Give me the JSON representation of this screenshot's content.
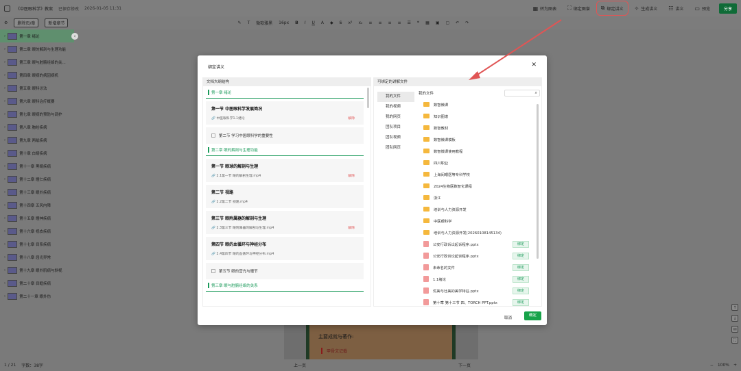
{
  "topbar": {
    "doc_title": "《中医眼科学》教案",
    "save_status": "已保存修改",
    "save_time": "2026-01-05 11:31",
    "buttons": [
      {
        "label": "转为图表",
        "icon": "chart-icon"
      },
      {
        "label": "绑定图谱",
        "icon": "graph-icon"
      },
      {
        "label": "绑定讲义",
        "icon": "handout-icon"
      },
      {
        "label": "生成讲义",
        "icon": "generate-icon"
      },
      {
        "label": "讲义",
        "icon": "doc-icon"
      },
      {
        "label": "预览",
        "icon": "preview-icon"
      }
    ],
    "share_label": "分享"
  },
  "toolbar2": {
    "delete_label": "删除页/章",
    "new_chapter_label": "新增章节",
    "font_name": "微软雅黑",
    "font_size": "16px"
  },
  "sidebar": {
    "items": [
      "第一章 绪论",
      "第二章 眼的解剖与生理功能",
      "第三章 眼与脏腑经络的关...",
      "第四章 眼病的病因病机",
      "第五章 眼科诊法",
      "第六章 眼科治疗概要",
      "第七章 眼病的预防与调护",
      "第八章 胞睑疾病",
      "第九章 两眦疾病",
      "第十章 白睛疾病",
      "第十一章 黑睛疾病",
      "第十二章 瞳仁疾病",
      "第十三章 眼外疾病",
      "第十四章 五风内障",
      "第十五章 瞳神疾病",
      "第十六章 视衣疾病",
      "第十七章 目系疾病",
      "第十八章 屈光异常",
      "第十九章 眼外肌病与斜视",
      "第二十章 目眶疾病",
      "第二十一章 眼外伤"
    ]
  },
  "statusbar": {
    "page_info": "1 / 21",
    "word_count": "字数：38字",
    "prev_label": "上一页",
    "next_label": "下一页",
    "zoom": "100%"
  },
  "canvas": {
    "line1": "主要成就与著作:",
    "line2": "甲骨文记载"
  },
  "modal": {
    "title": "绑定讲义",
    "left_header": "文档大纲结构",
    "right_header": "可绑定的讲解文件",
    "outline": [
      {
        "type": "chapter",
        "title": "第一章 绪论"
      },
      {
        "type": "section",
        "title": "第一节  中医眼科学发展简况",
        "file": "中医眼科学1.1绪论",
        "unbind": "解除"
      },
      {
        "type": "plain",
        "title": "第二节  学习中医眼科学的重要性"
      },
      {
        "type": "chapter",
        "title": "第二章  眼的解剖与生理功能"
      },
      {
        "type": "section",
        "title": "第一节  眼球的解剖与生理",
        "file": "2.1第一节 眼的解剖生理.mp4",
        "unbind": "解除"
      },
      {
        "type": "section",
        "title": "第二节  视路",
        "file": "2.2第二节 视路.mp4",
        "unbind": ""
      },
      {
        "type": "section",
        "title": "第三节  眼附属器的解剖与生理",
        "file": "2.3第三节 眼附属器的解剖与生理.mp4",
        "unbind": "解除"
      },
      {
        "type": "section",
        "title": "第四节  眼的血循环与神经分布",
        "file": "2.4第四节 眼的血循环与神经分布.mp4",
        "unbind": ""
      },
      {
        "type": "plain",
        "title": "第五节  眼的营光与瞳节"
      },
      {
        "type": "chapter",
        "title": "第三章  眼与脏腑经络的关系"
      }
    ],
    "nav": [
      "我的文件",
      "我的视频",
      "我的网页",
      "团队项目",
      "团队视频",
      "团队网页"
    ],
    "files_header": "我的文件",
    "files": [
      {
        "type": "folder",
        "name": "数智微课",
        "bind": ""
      },
      {
        "type": "folder",
        "name": "知识图谱",
        "bind": ""
      },
      {
        "type": "folder",
        "name": "数智教材",
        "bind": ""
      },
      {
        "type": "folder",
        "name": "数智微课模板",
        "bind": ""
      },
      {
        "type": "folder",
        "name": "数智微课使用教程",
        "bind": ""
      },
      {
        "type": "folder",
        "name": "四川职业",
        "bind": ""
      },
      {
        "type": "folder",
        "name": "上海闵眼医等专科学校",
        "bind": ""
      },
      {
        "type": "folder",
        "name": "2024生物医数智化课程",
        "bind": ""
      },
      {
        "type": "folder",
        "name": "浙江",
        "bind": ""
      },
      {
        "type": "folder",
        "name": "培训与人力资源开发",
        "bind": ""
      },
      {
        "type": "folder",
        "name": "中医眼科学",
        "bind": ""
      },
      {
        "type": "folder",
        "name": "培训与人力资源开发(20260108145134)",
        "bind": ""
      },
      {
        "type": "doc",
        "name": "公安行政诉讼起诉程序.pptx",
        "bind": "绑定"
      },
      {
        "type": "doc",
        "name": "公安行政诉讼起诉程序.pptx",
        "bind": "绑定"
      },
      {
        "type": "doc",
        "name": "未命名的文件",
        "bind": "绑定"
      },
      {
        "type": "doc",
        "name": "1.1绪论",
        "bind": "绑定"
      },
      {
        "type": "doc",
        "name": "优美与壮美的美学特征.pptx",
        "bind": "绑定"
      },
      {
        "type": "doc",
        "name": "第十章 第十三节 四、TORCH PPT.pptx",
        "bind": "绑定"
      }
    ],
    "cancel_label": "取消",
    "confirm_label": "确定"
  },
  "colors": {
    "accent": "#17a34a",
    "annotation": "#e05555",
    "folder": "#f5b83d"
  }
}
